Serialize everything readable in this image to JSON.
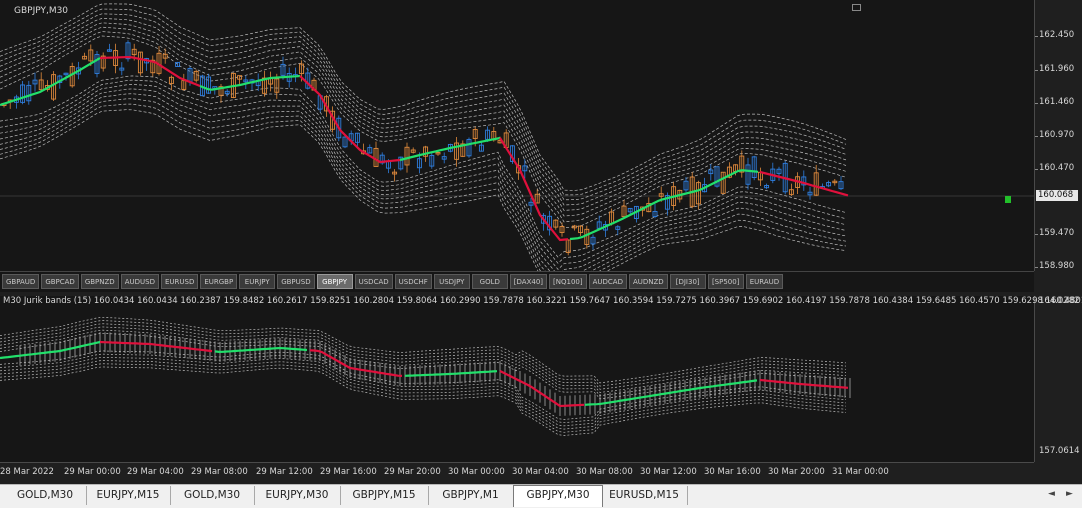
{
  "chart_title": "GBPJPY,M30",
  "price_scale": [
    "162.450",
    "161.960",
    "161.460",
    "160.970",
    "160.470",
    "159.470",
    "158.980"
  ],
  "current_price": "160.068",
  "symbols": [
    "GBPAUD",
    "GBPCAD",
    "GBPNZD",
    "AUDUSD",
    "EURUSD",
    "EURGBP",
    "EURJPY",
    "GBPUSD",
    "GBPJPY",
    "USDCAD",
    "USDCHF",
    "USDJPY",
    "GOLD",
    "[DAX40]",
    "[NQ100]",
    "AUDCAD",
    "AUDNZD",
    "[DJI30]",
    "[SP500]",
    "EURAUD"
  ],
  "active_symbol": "GBPJPY",
  "indicator_label": "M30 Jurik bands (15) 160.0434 160.0434 160.2387 159.8482 160.2617 159.8251 160.2804 159.8064 160.2990 159.7878 160.3221 159.7647 160.3594 159.7275 160.3967 159.6902 160.4197 159.7878 160.4384 159.6485 160.4570 159.6298 160.4801",
  "sub_scale": [
    "164.0282",
    "157.0614"
  ],
  "time_labels": [
    "28 Mar 2022",
    "29 Mar 00:00",
    "29 Mar 04:00",
    "29 Mar 08:00",
    "29 Mar 12:00",
    "29 Mar 16:00",
    "29 Mar 20:00",
    "30 Mar 00:00",
    "30 Mar 04:00",
    "30 Mar 08:00",
    "30 Mar 12:00",
    "30 Mar 16:00",
    "30 Mar 20:00",
    "31 Mar 00:00"
  ],
  "tabs": [
    "GOLD,M30",
    "EURJPY,M15",
    "GOLD,M30",
    "EURJPY,M30",
    "GBPJPY,M15",
    "GBPJPY,M1",
    "GBPJPY,M30",
    "EURUSD,M15"
  ],
  "active_tab": "GBPJPY,M30",
  "nav": {
    "left": "◄",
    "right": "►"
  },
  "colors": {
    "up_trend": "#22e06b",
    "down_trend": "#e0103c",
    "bull_candle": "#2f7fe0",
    "bear_candle": "#e08a3c",
    "bands": "#d8d8d8",
    "marker": "#22c02a"
  }
}
